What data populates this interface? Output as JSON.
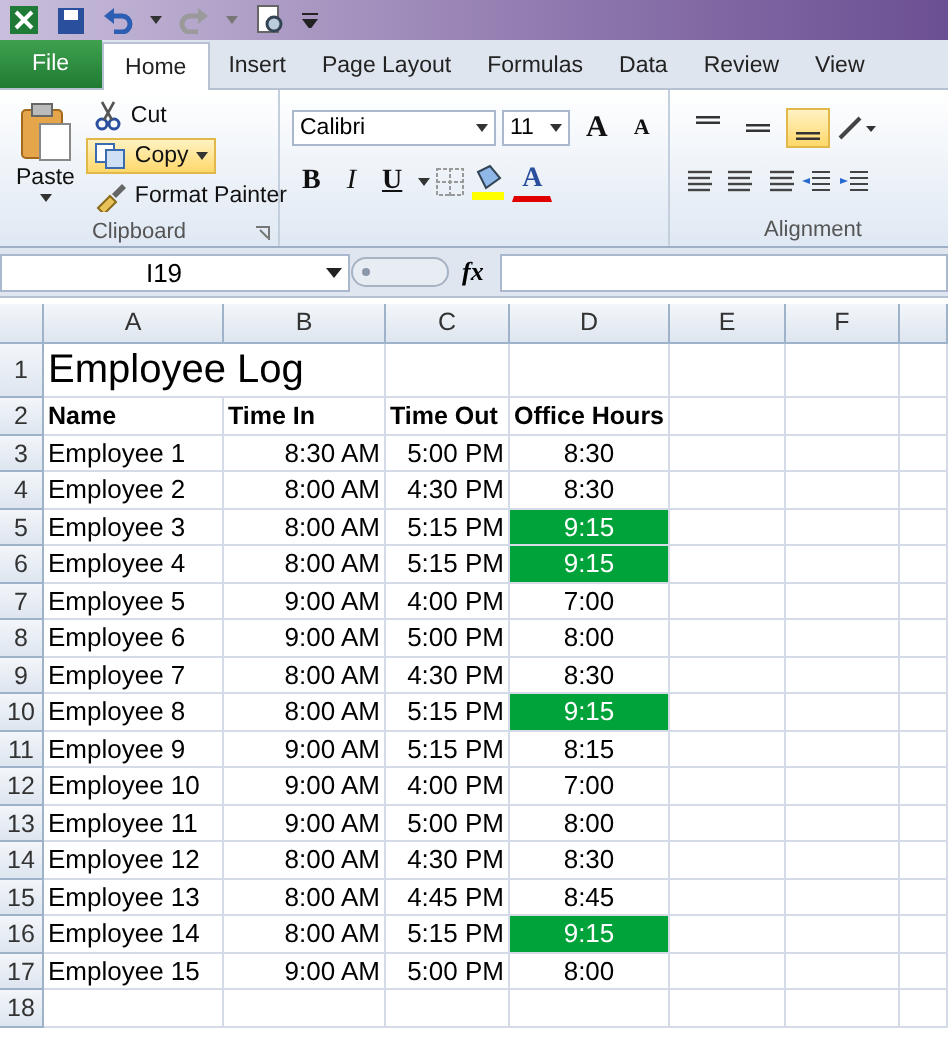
{
  "tabs": [
    {
      "label": "File",
      "kind": "file",
      "selected": false
    },
    {
      "label": "Home",
      "kind": "tab",
      "selected": true
    },
    {
      "label": "Insert",
      "kind": "tab",
      "selected": false
    },
    {
      "label": "Page Layout",
      "kind": "tab",
      "selected": false
    },
    {
      "label": "Formulas",
      "kind": "tab",
      "selected": false
    },
    {
      "label": "Data",
      "kind": "tab",
      "selected": false
    },
    {
      "label": "Review",
      "kind": "tab",
      "selected": false
    },
    {
      "label": "View",
      "kind": "tab",
      "selected": false
    }
  ],
  "clipboard": {
    "paste": "Paste",
    "cut": "Cut",
    "copy": "Copy",
    "copy_highlighted": true,
    "format_painter": "Format Painter",
    "label": "Clipboard"
  },
  "font": {
    "name": "Calibri",
    "size": "11",
    "grow": "A",
    "shrink": "A",
    "bold": "B",
    "italic": "I",
    "underline": "U",
    "font_color_button": "A"
  },
  "alignment": {
    "label": "Alignment",
    "buttons": [
      {
        "kind": "top",
        "selected": false
      },
      {
        "kind": "middle",
        "selected": false
      },
      {
        "kind": "bottom",
        "selected": true
      }
    ]
  },
  "formula_bar": {
    "name_box": "I19",
    "fx": "fx"
  },
  "sheet": {
    "columns": [
      "A",
      "B",
      "C",
      "D",
      "E",
      "F"
    ],
    "rows": [
      {
        "number": "1",
        "kind": "title",
        "cells": [
          "Employee Log"
        ]
      },
      {
        "number": "2",
        "kind": "header",
        "cells": [
          "Name",
          "Time In",
          "Time Out",
          "Office Hours"
        ]
      },
      {
        "number": "3",
        "kind": "data",
        "highlighted": false,
        "cells": [
          "Employee 1",
          "8:30 AM",
          "5:00 PM",
          "8:30"
        ]
      },
      {
        "number": "4",
        "kind": "data",
        "highlighted": false,
        "cells": [
          "Employee 2",
          "8:00 AM",
          "4:30 PM",
          "8:30"
        ]
      },
      {
        "number": "5",
        "kind": "data",
        "highlighted": true,
        "cells": [
          "Employee 3",
          "8:00 AM",
          "5:15 PM",
          "9:15"
        ]
      },
      {
        "number": "6",
        "kind": "data",
        "highlighted": true,
        "cells": [
          "Employee 4",
          "8:00 AM",
          "5:15 PM",
          "9:15"
        ]
      },
      {
        "number": "7",
        "kind": "data",
        "highlighted": false,
        "cells": [
          "Employee 5",
          "9:00 AM",
          "4:00 PM",
          "7:00"
        ]
      },
      {
        "number": "8",
        "kind": "data",
        "highlighted": false,
        "cells": [
          "Employee 6",
          "9:00 AM",
          "5:00 PM",
          "8:00"
        ]
      },
      {
        "number": "9",
        "kind": "data",
        "highlighted": false,
        "cells": [
          "Employee 7",
          "8:00 AM",
          "4:30 PM",
          "8:30"
        ]
      },
      {
        "number": "10",
        "kind": "data",
        "highlighted": true,
        "cells": [
          "Employee 8",
          "8:00 AM",
          "5:15 PM",
          "9:15"
        ]
      },
      {
        "number": "11",
        "kind": "data",
        "highlighted": false,
        "cells": [
          "Employee 9",
          "9:00 AM",
          "5:15 PM",
          "8:15"
        ]
      },
      {
        "number": "12",
        "kind": "data",
        "highlighted": false,
        "cells": [
          "Employee 10",
          "9:00 AM",
          "4:00 PM",
          "7:00"
        ]
      },
      {
        "number": "13",
        "kind": "data",
        "highlighted": false,
        "cells": [
          "Employee 11",
          "9:00 AM",
          "5:00 PM",
          "8:00"
        ]
      },
      {
        "number": "14",
        "kind": "data",
        "highlighted": false,
        "cells": [
          "Employee 12",
          "8:00 AM",
          "4:30 PM",
          "8:30"
        ]
      },
      {
        "number": "15",
        "kind": "data",
        "highlighted": false,
        "cells": [
          "Employee 13",
          "8:00 AM",
          "4:45 PM",
          "8:45"
        ]
      },
      {
        "number": "16",
        "kind": "data",
        "highlighted": true,
        "cells": [
          "Employee 14",
          "8:00 AM",
          "5:15 PM",
          "9:15"
        ]
      },
      {
        "number": "17",
        "kind": "data",
        "highlighted": false,
        "cells": [
          "Employee 15",
          "9:00 AM",
          "5:00 PM",
          "8:00"
        ]
      },
      {
        "number": "18",
        "kind": "empty",
        "cells": []
      }
    ]
  }
}
